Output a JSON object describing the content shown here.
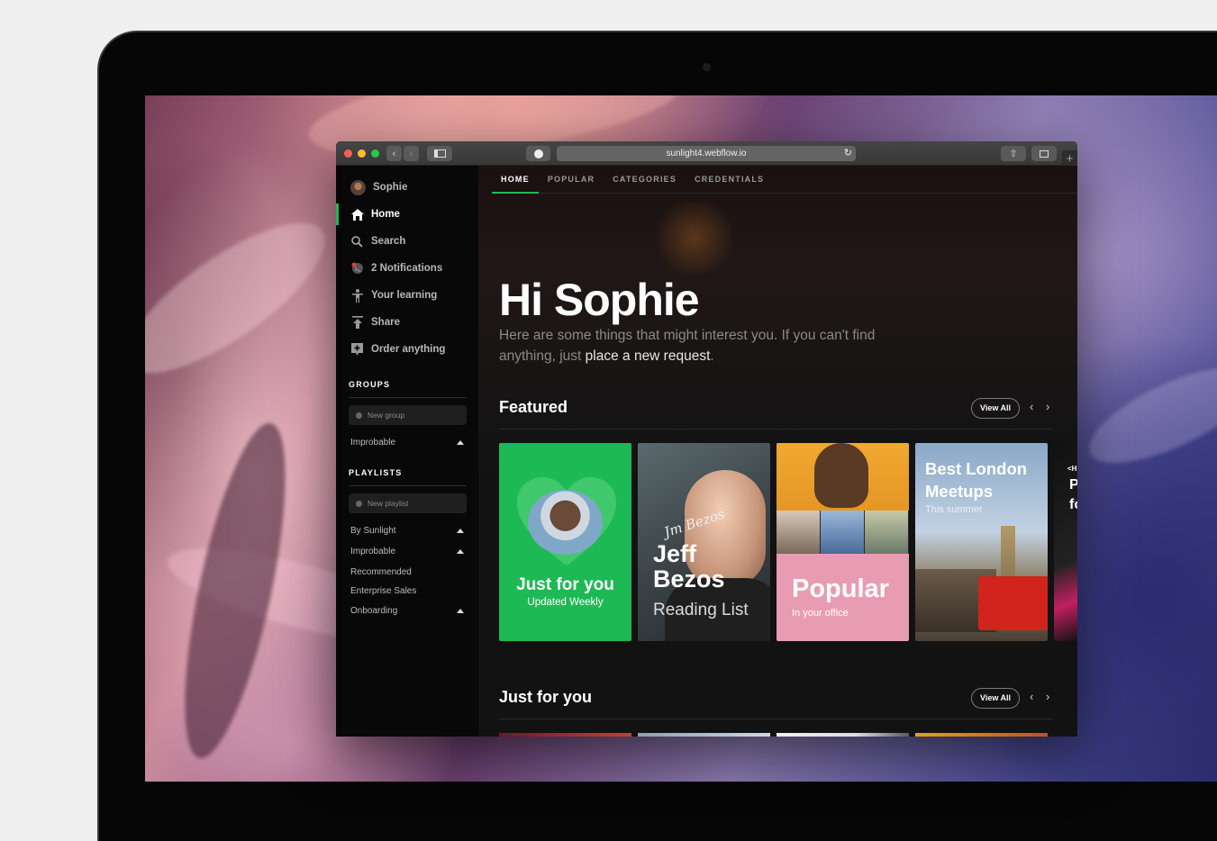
{
  "browser": {
    "url": "sunlight4.webflow.io"
  },
  "sidebar": {
    "user_name": "Sophie",
    "items": [
      {
        "label": "Home",
        "icon": "home-icon"
      },
      {
        "label": "Search",
        "icon": "search-icon"
      },
      {
        "label": "2 Notifications",
        "icon": "globe-icon"
      },
      {
        "label": "Your learning",
        "icon": "person-icon"
      },
      {
        "label": "Share",
        "icon": "upload-icon"
      },
      {
        "label": "Order anything",
        "icon": "plus-box-icon"
      }
    ],
    "groups_label": "GROUPS",
    "new_group_placeholder": "New group",
    "groups": [
      "Improbable"
    ],
    "playlists_label": "PLAYLISTS",
    "new_playlist_placeholder": "New playlist",
    "playlists": [
      "By Sunlight",
      "Improbable",
      "Recommended",
      "Enterprise Sales",
      "Onboarding"
    ]
  },
  "tabs": [
    "HOME",
    "POPULAR",
    "CATEGORIES",
    "CREDENTIALS"
  ],
  "hero": {
    "title": "Hi Sophie",
    "subtitle": "Here are some things that might interest you. If you can't find anything, just",
    "link": "place a new request",
    "end": "."
  },
  "featured": {
    "title": "Featured",
    "view_all": "View All",
    "cards": [
      {
        "title": "Just for you",
        "subtitle": "Updated Weekly",
        "color": "#1db954"
      },
      {
        "title1": "Jeff",
        "title2": "Bezos",
        "subtitle": "Reading List",
        "signature": "Jm Bezos"
      },
      {
        "title": "Popular",
        "subtitle": "In your office",
        "color": "#e89cb4"
      },
      {
        "title1": "Best London",
        "title2": "Meetups",
        "subtitle": "This summer"
      },
      {
        "fragment1": "<H",
        "fragment2": "P",
        "fragment3": "fo"
      }
    ]
  },
  "just_for_you": {
    "title": "Just for you",
    "view_all": "View All"
  },
  "colors": {
    "accent": "#1db954",
    "bg": "#121212",
    "sidebar": "#080808"
  }
}
